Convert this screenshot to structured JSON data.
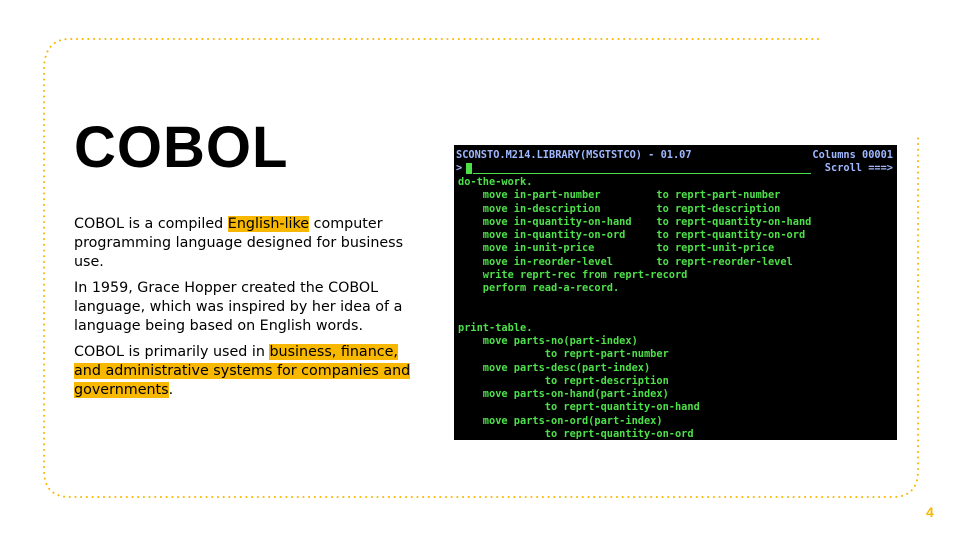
{
  "slide": {
    "title": "COBOL",
    "accent_color": "#f9b800",
    "page_number": "4",
    "paragraphs": [
      {
        "before": "COBOL is a compiled ",
        "highlight": "English-like",
        "after": " computer programming language designed for business use."
      },
      {
        "text": " In 1959, Grace Hopper created the COBOL language, which was inspired by her idea of a language being based on English words."
      },
      {
        "before": "COBOL is primarily used in ",
        "highlight": "business, finance, and administrative systems for companies and governments",
        "after": "."
      }
    ]
  },
  "terminal": {
    "dataset": "SCONSTO.M214.LIBRARY(MSGTSTCO) - 01.07",
    "columns": "Columns 00001",
    "prompt": ">",
    "scroll": "Scroll ===>",
    "lines": [
      "do-the-work.",
      "    move in-part-number         to reprt-part-number",
      "    move in-description         to reprt-description",
      "    move in-quantity-on-hand    to reprt-quantity-on-hand",
      "    move in-quantity-on-ord     to reprt-quantity-on-ord",
      "    move in-unit-price          to reprt-unit-price",
      "    move in-reorder-level       to reprt-reorder-level",
      "    write reprt-rec from reprt-record",
      "    perform read-a-record.",
      "",
      "",
      "print-table.",
      "    move parts-no(part-index)",
      "              to reprt-part-number",
      "    move parts-desc(part-index)",
      "              to reprt-description",
      "    move parts-on-hand(part-index)",
      "              to reprt-quantity-on-hand",
      "    move parts-on-ord(part-index)",
      "              to reprt-quantity-on-ord"
    ]
  }
}
